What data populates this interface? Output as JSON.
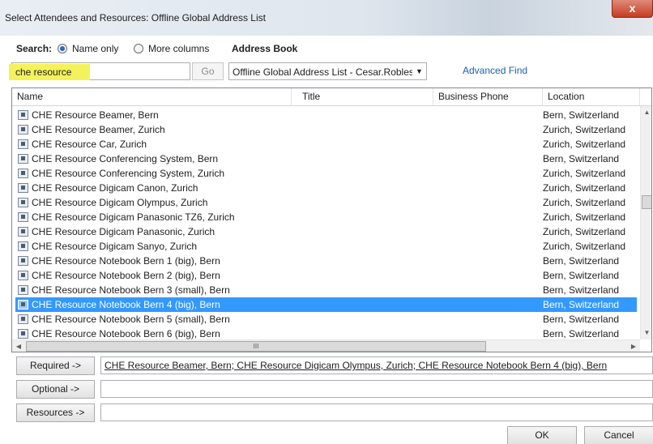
{
  "window": {
    "title": "Select Attendees and Resources: Offline Global Address List",
    "close_glyph": "x"
  },
  "search": {
    "label": "Search:",
    "option_name_only": "Name only",
    "option_more_columns": "More columns",
    "selected_option": "Name only",
    "value": "che resource",
    "go_label": "Go"
  },
  "address_book": {
    "label": "Address Book",
    "selected": "Offline Global Address List - Cesar.Robles@",
    "advanced_find": "Advanced Find"
  },
  "columns": [
    "Name",
    "Title",
    "Business Phone",
    "Location"
  ],
  "rows": [
    {
      "name": "CHE Resource Beamer, Bern",
      "location": "Bern, Switzerland",
      "selected": false
    },
    {
      "name": "CHE Resource Beamer, Zurich",
      "location": "Zurich, Switzerland",
      "selected": false
    },
    {
      "name": "CHE Resource Car, Zurich",
      "location": "Zurich, Switzerland",
      "selected": false
    },
    {
      "name": "CHE Resource Conferencing System, Bern",
      "location": "Bern, Switzerland",
      "selected": false
    },
    {
      "name": "CHE Resource Conferencing System, Zurich",
      "location": "Zurich, Switzerland",
      "selected": false
    },
    {
      "name": "CHE Resource Digicam Canon, Zurich",
      "location": "Zurich, Switzerland",
      "selected": false
    },
    {
      "name": "CHE Resource Digicam Olympus, Zurich",
      "location": "Zurich, Switzerland",
      "selected": false
    },
    {
      "name": "CHE Resource Digicam Panasonic TZ6, Zurich",
      "location": "Zurich, Switzerland",
      "selected": false
    },
    {
      "name": "CHE Resource Digicam Panasonic, Zurich",
      "location": "Zurich, Switzerland",
      "selected": false
    },
    {
      "name": "CHE Resource Digicam Sanyo, Zurich",
      "location": "Zurich, Switzerland",
      "selected": false
    },
    {
      "name": "CHE Resource Notebook Bern 1 (big), Bern",
      "location": "Bern, Switzerland",
      "selected": false
    },
    {
      "name": "CHE Resource Notebook Bern 2 (big), Bern",
      "location": "Bern, Switzerland",
      "selected": false
    },
    {
      "name": "CHE Resource Notebook Bern 3 (small), Bern",
      "location": "Bern, Switzerland",
      "selected": false
    },
    {
      "name": "CHE Resource Notebook Bern 4 (big), Bern",
      "location": "Bern, Switzerland",
      "selected": true
    },
    {
      "name": "CHE Resource Notebook Bern 5 (small), Bern",
      "location": "Bern, Switzerland",
      "selected": false
    },
    {
      "name": "CHE Resource Notebook Bern 6 (big), Bern",
      "location": "Bern, Switzerland",
      "selected": false
    }
  ],
  "scroll": {
    "hthumb_glyph": "III"
  },
  "recipients": {
    "required_label": "Required ->",
    "required_value": "CHE Resource Beamer, Bern; CHE Resource Digicam Olympus, Zurich; CHE Resource Notebook Bern 4 (big), Bern",
    "optional_label": "Optional ->",
    "optional_value": "",
    "resources_label": "Resources ->",
    "resources_value": ""
  },
  "buttons": {
    "ok": "OK",
    "cancel": "Cancel"
  },
  "colors": {
    "selection": "#3399ff",
    "link": "#1a5fb4",
    "highlight": "#f4f25a",
    "close": "#c63c22"
  }
}
